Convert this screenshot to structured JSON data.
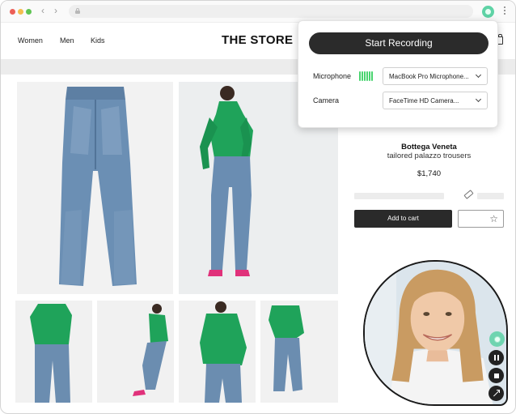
{
  "browser": {
    "icons": [
      "back-arrow-icon",
      "forward-arrow-icon",
      "lock-icon",
      "extension-icon",
      "more-vertical-icon"
    ],
    "traffic_light_colors": [
      "#ec5f57",
      "#f3bd4f",
      "#5fc453"
    ]
  },
  "store": {
    "nav": [
      {
        "label": "Women"
      },
      {
        "label": "Men"
      },
      {
        "label": "Kids"
      }
    ],
    "logo": "THE STORE",
    "cart_icon": "shopping-bag-icon"
  },
  "product": {
    "brand": "Bottega Veneta",
    "name": "tailored palazzo trousers",
    "price": "$1,740",
    "add_to_cart_label": "Add to cart",
    "wishlist_icon": "star-icon",
    "size_guide_icon": "ruler-icon"
  },
  "recording_popup": {
    "start_label": "Start Recording",
    "microphone_label": "Microphone",
    "microphone_value": "MacBook Pro Microphone...",
    "camera_label": "Camera",
    "camera_value": "FaceTime HD Camera...",
    "mic_level_color": "#48d46e"
  },
  "camera_bubble": {
    "controls": [
      "extension-icon",
      "pause-icon",
      "stop-icon",
      "expand-icon"
    ],
    "accent_color": "#6fd4b0"
  }
}
